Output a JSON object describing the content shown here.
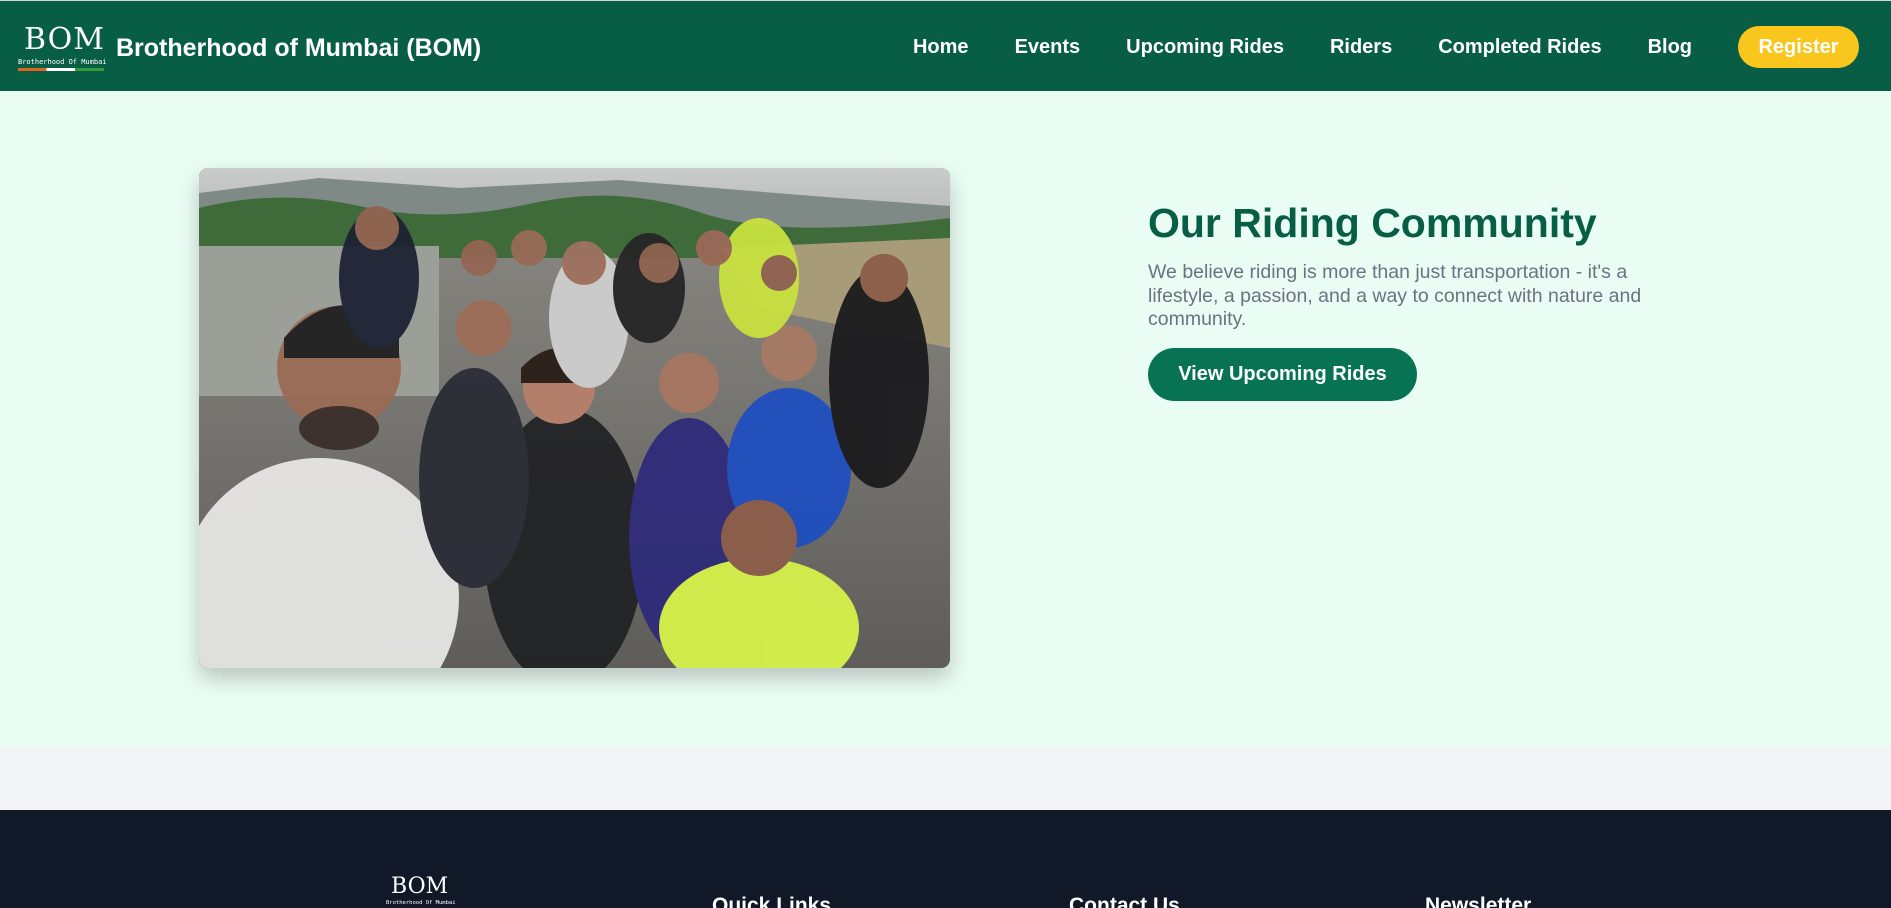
{
  "header": {
    "logo_text": "BOM",
    "logo_subtext": "Brotherhood Of Mumbai",
    "title": "Brotherhood of Mumbai (BOM)",
    "nav": [
      "Home",
      "Events",
      "Upcoming Rides",
      "Riders",
      "Completed Rides",
      "Blog"
    ],
    "register_label": "Register"
  },
  "hero": {
    "title": "Our Riding Community",
    "description": "We believe riding is more than just transportation - it's a lifestyle, a passion, and a way to connect with nature and community.",
    "button_label": "View Upcoming Rides"
  },
  "footer": {
    "logo_text": "BOM",
    "logo_subtext": "Brotherhood Of Mumbai",
    "columns": [
      "Quick Links",
      "Contact Us",
      "Newsletter"
    ]
  },
  "colors": {
    "brand_green": "#075e45",
    "accent_yellow": "#f8c61c",
    "hero_bg": "#eafdf4",
    "footer_bg": "#111827"
  }
}
